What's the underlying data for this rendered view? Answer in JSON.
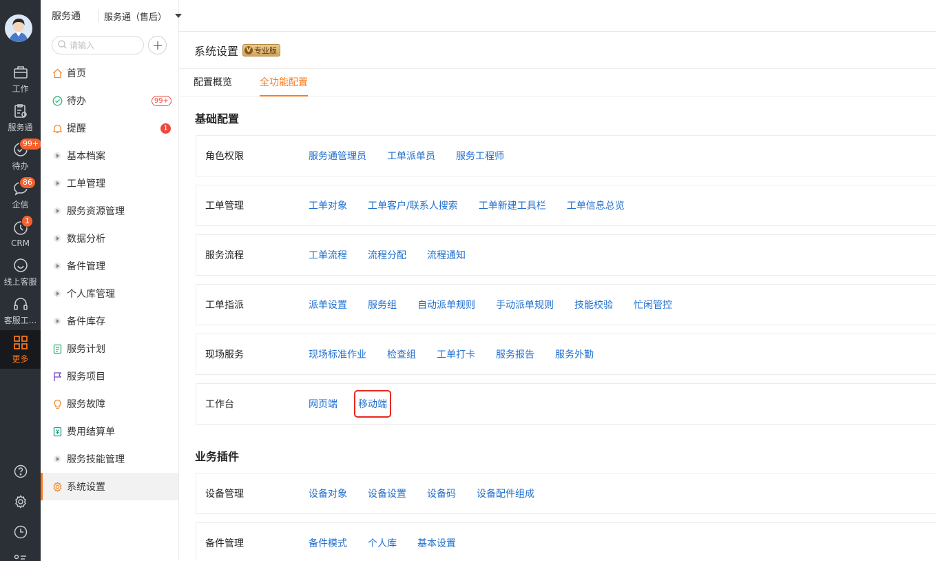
{
  "rail": {
    "items": [
      {
        "label": "工作",
        "icon": "briefcase-icon"
      },
      {
        "label": "服务通",
        "icon": "clipboard-settings-icon"
      },
      {
        "label": "待办",
        "icon": "check-circle-icon",
        "badge": "99+"
      },
      {
        "label": "企信",
        "icon": "chat-bubble-icon",
        "badge": "86"
      },
      {
        "label": "CRM",
        "icon": "clock-icon",
        "badge": "1"
      },
      {
        "label": "线上客服",
        "icon": "smile-icon"
      },
      {
        "label": "客服工...",
        "icon": "headset-icon"
      },
      {
        "label": "更多",
        "icon": "grid-icon"
      }
    ],
    "bottom_icons": [
      "help-icon",
      "gear-icon",
      "history-icon",
      "list-icon"
    ]
  },
  "topbar": {
    "app_name": "服务通",
    "switcher": "服务通（售后）"
  },
  "sidebar": {
    "search_placeholder": "请输入",
    "items": [
      {
        "label": "首页",
        "icon": "home-icon"
      },
      {
        "label": "待办",
        "icon": "check-circle-icon",
        "badge": "99+"
      },
      {
        "label": "提醒",
        "icon": "bell-icon",
        "badge": "1"
      },
      {
        "label": "基本档案",
        "icon": "caret-icon"
      },
      {
        "label": "工单管理",
        "icon": "caret-icon"
      },
      {
        "label": "服务资源管理",
        "icon": "caret-icon"
      },
      {
        "label": "数据分析",
        "icon": "caret-icon"
      },
      {
        "label": "备件管理",
        "icon": "caret-icon"
      },
      {
        "label": "个人库管理",
        "icon": "caret-icon"
      },
      {
        "label": "备件库存",
        "icon": "caret-icon"
      },
      {
        "label": "服务计划",
        "icon": "document-icon"
      },
      {
        "label": "服务项目",
        "icon": "flag-icon"
      },
      {
        "label": "服务故障",
        "icon": "bulb-icon"
      },
      {
        "label": "费用结算单",
        "icon": "receipt-icon"
      },
      {
        "label": "服务技能管理",
        "icon": "caret-icon"
      },
      {
        "label": "系统设置",
        "icon": "gear-icon"
      }
    ]
  },
  "main": {
    "title": "系统设置",
    "pro_badge": "专业版",
    "tabs": [
      "配置概览",
      "全功能配置"
    ],
    "sections": [
      {
        "title": "基础配置",
        "rows": [
          {
            "name": "角色权限",
            "links": [
              "服务通管理员",
              "工单派单员",
              "服务工程师"
            ]
          },
          {
            "name": "工单管理",
            "links": [
              "工单对象",
              "工单客户/联系人搜索",
              "工单新建工具栏",
              "工单信息总览"
            ]
          },
          {
            "name": "服务流程",
            "links": [
              "工单流程",
              "流程分配",
              "流程通知"
            ]
          },
          {
            "name": "工单指派",
            "links": [
              "派单设置",
              "服务组",
              "自动派单规则",
              "手动派单规则",
              "技能校验",
              "忙闲管控"
            ]
          },
          {
            "name": "现场服务",
            "links": [
              "现场标准作业",
              "检查组",
              "工单打卡",
              "服务报告",
              "服务外勤"
            ]
          },
          {
            "name": "工作台",
            "links": [
              "网页端",
              "移动端"
            ]
          }
        ]
      },
      {
        "title": "业务插件",
        "rows": [
          {
            "name": "设备管理",
            "links": [
              "设备对象",
              "设备设置",
              "设备码",
              "设备配件组成"
            ]
          },
          {
            "name": "备件管理",
            "links": [
              "备件模式",
              "个人库",
              "基本设置"
            ]
          }
        ]
      }
    ]
  }
}
